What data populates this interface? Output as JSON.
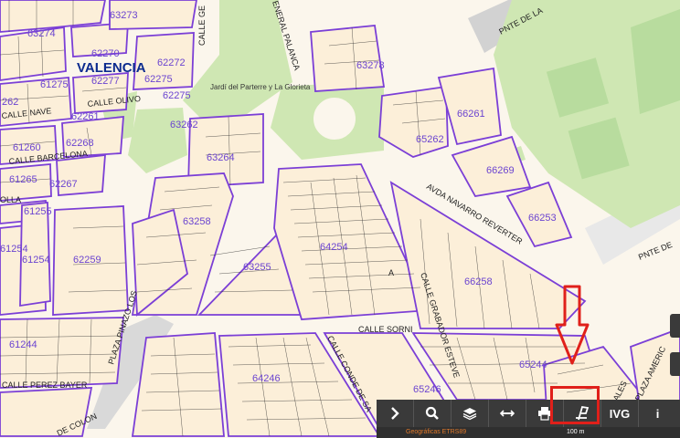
{
  "city_label": "VALENCIA",
  "parks": [
    {
      "name": "Jardí del Parterre y La Glorieta"
    }
  ],
  "parcels": [
    "63274",
    "62270",
    "62272",
    "62275",
    "62277",
    "62275",
    "61275",
    "262",
    "62261",
    "61260",
    "62268",
    "61265",
    "62267",
    "63273",
    "63278",
    "63262",
    "63264",
    "66261",
    "65262",
    "66269",
    "66253",
    "63258",
    "64254",
    "63255",
    "61255",
    "62259",
    "61254",
    "61254",
    "66258",
    "61244",
    "65244",
    "64246",
    "65246"
  ],
  "streets": [
    "CALLE GE",
    "ENERAL PALANCA",
    "PNTE DE LA",
    "AVDA NAVARRO REVERTER",
    "PNTE DE",
    "CALLE SORNI",
    "CALLE GRABADOR ESTEVE",
    "CALLE CONDE DE SA",
    "PLAZA PINAZO LOS",
    "CALLE PEREZ BAYER",
    "DE COLON",
    "CALLE OLIVO",
    "CALLE NAVE",
    "CALLE BARCELONA",
    "OLLA",
    "PLAZA AMERIC",
    "ALES",
    "A"
  ],
  "toolbar": {
    "buttons": [
      {
        "id": "expand",
        "label": "",
        "icon": "chevron-right-icon"
      },
      {
        "id": "search",
        "label": "",
        "icon": "search-icon"
      },
      {
        "id": "layers",
        "label": "",
        "icon": "layers-icon"
      },
      {
        "id": "measure",
        "label": "",
        "icon": "measure-icon"
      },
      {
        "id": "print",
        "label": "",
        "icon": "print-icon"
      },
      {
        "id": "reference",
        "label": "",
        "icon": "reference-icon"
      },
      {
        "id": "ivg",
        "label": "IVG",
        "icon": ""
      },
      {
        "id": "info",
        "label": "i",
        "icon": "info-icon"
      }
    ]
  },
  "status": {
    "coordinates_label": "Geográficas ETRS89",
    "scale_label": "100 m"
  },
  "annotations": {
    "arrow_color": "#e0201a",
    "highlight_target": "reference"
  }
}
